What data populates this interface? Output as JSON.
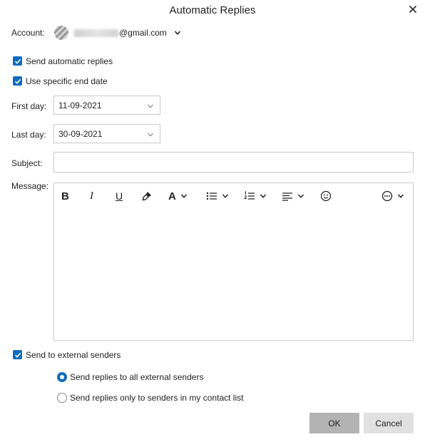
{
  "dialog": {
    "title": "Automatic Replies",
    "close_icon": "close-icon"
  },
  "account": {
    "label": "Account:",
    "email_suffix": "@gmail.com"
  },
  "options": {
    "send_automatic_replies": {
      "label": "Send automatic replies",
      "checked": true
    },
    "use_specific_end_date": {
      "label": "Use specific end date",
      "checked": true
    }
  },
  "first_day": {
    "label": "First day:",
    "value": "11-09-2021"
  },
  "last_day": {
    "label": "Last day:",
    "value": "30-09-2021"
  },
  "subject": {
    "label": "Subject:",
    "value": ""
  },
  "message": {
    "label": "Message:",
    "toolbar_icons": [
      "bold-icon",
      "italic-icon",
      "underline-icon",
      "format-painter-icon",
      "font-color-icon",
      "bullet-list-icon",
      "numbered-list-icon",
      "align-icon",
      "emoji-icon",
      "more-options-icon"
    ],
    "bold_glyph": "B",
    "italic_glyph": "I",
    "underline_glyph": "U",
    "font_glyph": "A",
    "body": ""
  },
  "external": {
    "label": "Send to external senders",
    "checked": true,
    "radio_all": {
      "label": "Send replies to all external senders",
      "selected": true
    },
    "radio_contacts": {
      "label": "Send replies only to senders in my contact list",
      "selected": false
    }
  },
  "buttons": {
    "ok": "OK",
    "cancel": "Cancel"
  },
  "colors": {
    "accent": "#0f6cbd",
    "ok_bg": "#b3b3b3",
    "cancel_bg": "#e1e1e1",
    "border": "#c8c8c8"
  }
}
